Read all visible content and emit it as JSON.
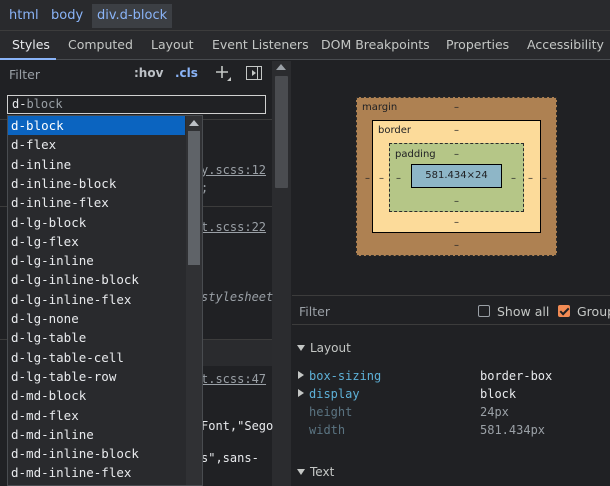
{
  "breadcrumb": {
    "items": [
      "html",
      "body",
      "div.d-block"
    ]
  },
  "tabs": [
    "Styles",
    "Computed",
    "Layout",
    "Event Listeners",
    "DOM Breakpoints",
    "Properties",
    "Accessibility"
  ],
  "styles": {
    "filter_placeholder": "Filter",
    "hov_label": ":hov",
    "cls_label": ".cls",
    "class_input": {
      "typed": "d-",
      "hint": "block"
    },
    "suggestions": [
      "d-block",
      "d-flex",
      "d-inline",
      "d-inline-block",
      "d-inline-flex",
      "d-lg-block",
      "d-lg-flex",
      "d-lg-inline",
      "d-lg-inline-block",
      "d-lg-inline-flex",
      "d-lg-none",
      "d-lg-table",
      "d-lg-table-cell",
      "d-lg-table-row",
      "d-md-block",
      "d-md-flex",
      "d-md-inline",
      "d-md-inline-block",
      "d-md-inline-flex"
    ],
    "selected_suggestion": "d-block",
    "background_fragments": {
      "link1": "y.scss:12",
      "semi1": ";",
      "link2": "t.scss:22",
      "stylesheet": "stylesheet",
      "link3": "t.scss:47",
      "font1": "Font,\"Sego",
      "font2": "s\",sans-"
    }
  },
  "box_model": {
    "margin_label": "margin",
    "border_label": "border",
    "padding_label": "padding",
    "content_size": "581.434×24",
    "dash": "–",
    "colors": {
      "margin": "#ae8152",
      "border": "#fcdb9a",
      "padding": "#b5c687",
      "content": "#8eb6c7"
    }
  },
  "computed": {
    "filter_placeholder": "Filter",
    "show_all_label": "Show all",
    "show_all_checked": false,
    "group_label": "Group",
    "group_checked": true,
    "layout_section": "Layout",
    "properties": [
      {
        "name": "box-sizing",
        "value": "border-box",
        "inherited": false
      },
      {
        "name": "display",
        "value": "block",
        "inherited": false
      },
      {
        "name": "height",
        "value": "24px",
        "inherited": true
      },
      {
        "name": "width",
        "value": "581.434px",
        "inherited": true
      }
    ],
    "text_section": "Text"
  },
  "colors": {
    "accent": "#8ab4f8",
    "selection": "#0b64c0",
    "property_name": "#5db0d7"
  }
}
